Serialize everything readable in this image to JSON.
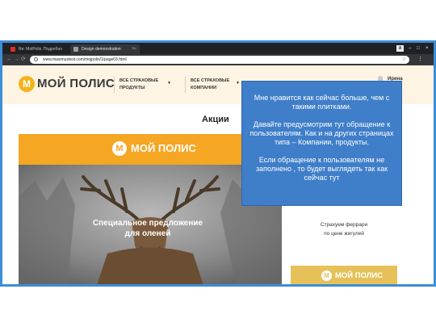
{
  "browser": {
    "tabs": [
      {
        "label": "Re: MoiPolis. Подробно",
        "favicon_color": "#d93025",
        "active": false
      },
      {
        "label": "Design demonstration",
        "favicon_color": "#9aa0a6",
        "active": true
      }
    ],
    "new_tab_glyph": "+",
    "tab_close_glyph": "×",
    "window_controls": [
      "–",
      "□",
      "×"
    ],
    "profile_letter": "A",
    "url": "www.maximustest.com/mojpolis/1/page03.html",
    "bookmark_icon": "star-icon",
    "nav_icons": [
      "back-arrow-icon",
      "forward-arrow-icon",
      "reload-icon"
    ]
  },
  "site": {
    "logo_mark": "М",
    "logo_text": "МОЙ ПОЛИС",
    "nav": [
      {
        "line1": "ВСЕ СТРАХОВЫЕ",
        "line2": "ПРОДУКТЫ"
      },
      {
        "line1": "ВСЕ СТРАХОВЫЕ",
        "line2": "КОМПАНИИ"
      }
    ],
    "user_name": "Ирина"
  },
  "main": {
    "section_title": "Акции",
    "promo_main": {
      "logo_mark": "М",
      "logo_text": "МОЙ ПОЛИС",
      "caption_line1": "Специальное предложение",
      "caption_line2": "для оленей"
    },
    "promo_side": {
      "caption_line1": "Страхуем феррари",
      "caption_line2": "по цене жигулей"
    },
    "promo_side2": {
      "logo_mark": "М",
      "logo_text": "МОЙ ПОЛИС"
    }
  },
  "note": {
    "paragraphs": [
      "Мне нравится как сейчас больше, чем с такими плитками.",
      "Давайте предусмотрим тут обращение к пользователям. Как и на других страницах типа – Компании, продукты.",
      "Если обращение к пользователям не заполнено , то будет выглядеть так как сейчас тут"
    ]
  },
  "colors": {
    "accent_orange": "#f5a623",
    "logo_yellow": "#f3b41b",
    "header_bg": "#fdf4e3",
    "note_blue": "#3f7ec9",
    "frame_blue": "#3b8ed8",
    "chrome_dark": "#202124"
  }
}
